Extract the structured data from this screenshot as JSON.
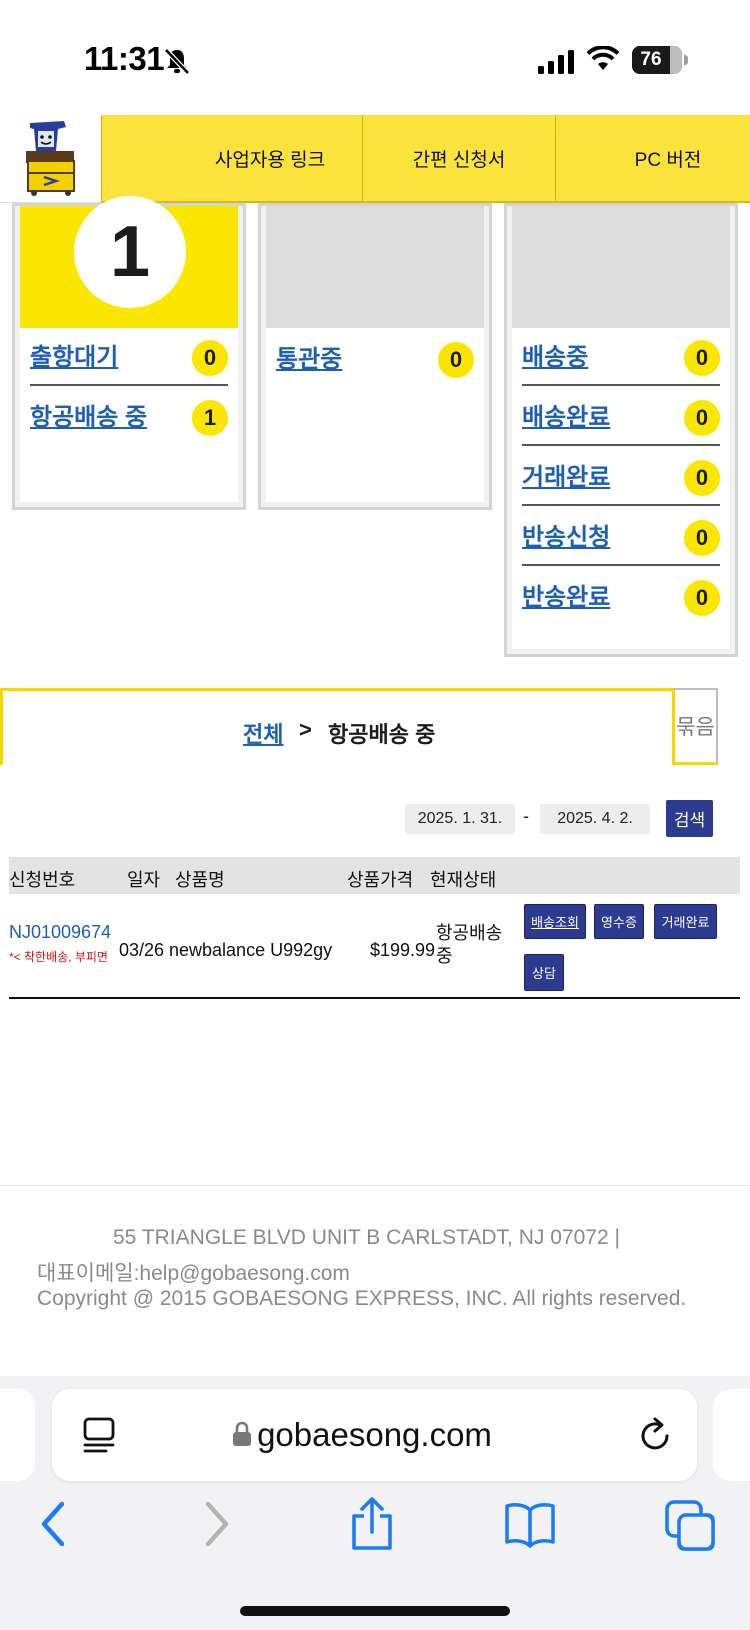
{
  "status_bar": {
    "time": "11:31",
    "battery_level": "76",
    "icons": [
      "bell-slash-icon",
      "cellular-signal-icon",
      "wifi-icon",
      "battery-icon"
    ]
  },
  "nav": {
    "logo_icon": "mascot-logo-icon",
    "tabs": [
      {
        "label": "사업자용 링크"
      },
      {
        "label": "간편 신청서"
      },
      {
        "label": "PC 버전"
      }
    ],
    "tab_color": "#fbe33b"
  },
  "cards": [
    {
      "count": "1",
      "rows": [
        {
          "label": "출항대기",
          "count": "0"
        },
        {
          "label": "항공배송 중",
          "count": "1"
        }
      ]
    },
    {
      "count": "",
      "rows": [
        {
          "label": "통관중",
          "count": "0"
        }
      ]
    },
    {
      "count": "",
      "rows": [
        {
          "label": "배송중",
          "count": "0"
        },
        {
          "label": "배송완료",
          "count": "0"
        },
        {
          "label": "거래완료",
          "count": "0"
        },
        {
          "label": "반송신청",
          "count": "0"
        },
        {
          "label": "반송완료",
          "count": "0"
        }
      ]
    }
  ],
  "breadcrumb": {
    "all": "전체",
    "separator": ">",
    "current": "항공배송 중",
    "bundle_button": "묶음"
  },
  "search": {
    "start_date": "2025. 1. 31.",
    "dash": "-",
    "end_date": "2025. 4. 2.",
    "button": "검색"
  },
  "table": {
    "headers": [
      "신청번호",
      "일자",
      "상품명",
      "상품가격",
      "현재상태"
    ],
    "rows": [
      {
        "order_no": "NJ01009674",
        "note": "*< 착한배송, 부피면",
        "date": "03/26",
        "product": "newbalance U992gy",
        "price": "$199.99",
        "status": "항공배송중",
        "actions": [
          "배송조회",
          "영수증",
          "거래완료",
          "상담"
        ]
      }
    ]
  },
  "footer": {
    "address": "55 TRIANGLE BLVD UNIT B CARLSTADT, NJ 07072  |",
    "email": "대표이메일:help@gobaesong.com",
    "copyright": "Copyright @ 2015 GOBAESONG EXPRESS, INC. All rights reserved."
  },
  "browser": {
    "url": "gobaesong.com",
    "toolbar_icons": [
      "back-icon",
      "forward-icon",
      "share-icon",
      "bookmarks-icon",
      "tabs-icon"
    ]
  },
  "colors": {
    "accent_yellow": "#fbe600",
    "link_blue": "#1d5fb3",
    "button_navy": "#2c3b8f",
    "ios_blue": "#1a7cf5"
  }
}
